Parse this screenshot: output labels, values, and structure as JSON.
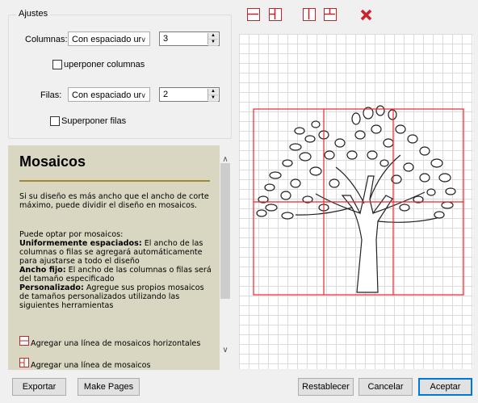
{
  "settings": {
    "title": "Ajustes",
    "columns_label": "Columnas:",
    "columns_mode": "Con espaciado ur",
    "columns_value": "3",
    "overlap_columns_label": "uperponer columnas",
    "rows_label": "Filas:",
    "rows_mode": "Con espaciado ur",
    "rows_value": "2",
    "overlap_rows_label": "Superponer filas"
  },
  "help": {
    "title": "Mosaicos",
    "intro": "Si su diseño es más ancho que el ancho de corte máximo, puede dividir el diseño en mosaicos.",
    "options_intro": "Puede optar por mosaicos:",
    "uniform_label": "Uniformemente espaciados:",
    "uniform_text": " El ancho de las columnas o filas se agregará automáticamente para ajustarse a todo el diseño",
    "fixed_label": "Ancho fijo:",
    "fixed_text": " El ancho de las columnas o filas será del tamaño especificado",
    "custom_label": "Personalizado:",
    "custom_text": " Agregue sus propios mosaicos de tamaños personalizados utilizando las siguientes herramientas",
    "tool1": "Agregar una línea de mosaicos horizontales",
    "tool2": "Agregar una línea de mosaicos"
  },
  "toolbar": {
    "icons": [
      "horizontal-split-icon",
      "horizontal-split-custom-icon",
      "vertical-split-icon",
      "vertical-split-custom-icon",
      "delete-tile-icon"
    ]
  },
  "buttons": {
    "export": "Exportar",
    "make_pages": "Make Pages",
    "reset": "Restablecer",
    "cancel": "Cancelar",
    "accept": "Aceptar"
  },
  "colors": {
    "tile_lines": "#e8262d",
    "help_background": "#d9d6c1",
    "help_rule": "#a5873a",
    "accept_border": "#0078d7"
  }
}
